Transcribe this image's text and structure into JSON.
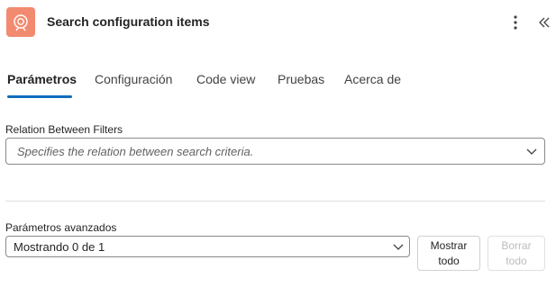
{
  "header": {
    "title": "Search configuration items",
    "icon": "service-request-icon",
    "icon_color": "#f28a70"
  },
  "tabs": [
    {
      "label": "Parámetros",
      "active": true
    },
    {
      "label": "Configuración",
      "active": false
    },
    {
      "label": "Code view",
      "active": false
    },
    {
      "label": "Pruebas",
      "active": false
    },
    {
      "label": "Acerca de",
      "active": false
    }
  ],
  "relation_field": {
    "label": "Relation Between Filters",
    "placeholder": "Specifies the relation between search criteria."
  },
  "advanced": {
    "label": "Parámetros avanzados",
    "selected": "Mostrando 0 de 1",
    "show_all_line1": "Mostrar",
    "show_all_line2": "todo",
    "clear_all_line1": "Borrar",
    "clear_all_line2": "todo"
  },
  "colors": {
    "accent": "#0f6cbd"
  }
}
